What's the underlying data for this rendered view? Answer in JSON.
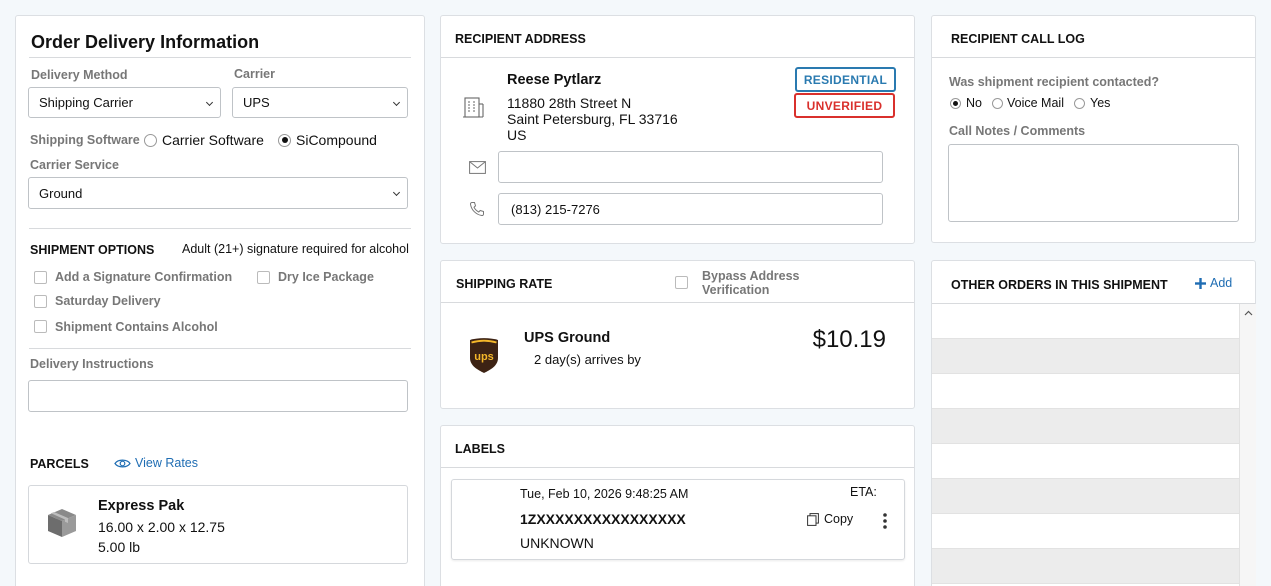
{
  "order": {
    "title": "Order Delivery Information",
    "delivery_method_label": "Delivery Method",
    "delivery_method_value": "Shipping Carrier",
    "carrier_label": "Carrier",
    "carrier_value": "UPS",
    "shipping_software_label": "Shipping Software",
    "software_options": [
      "Carrier Software",
      "SiCompound"
    ],
    "software_selected": "SiCompound",
    "carrier_service_label": "Carrier Service",
    "carrier_service_value": "Ground",
    "shipment_options_header": "SHIPMENT OPTIONS",
    "alcohol_note": "Adult (21+) signature required for alcohol",
    "options": {
      "signature": "Add a Signature Confirmation",
      "dry_ice": "Dry Ice Package",
      "saturday": "Saturday Delivery",
      "alcohol": "Shipment Contains Alcohol"
    },
    "delivery_instructions_label": "Delivery Instructions",
    "delivery_instructions_value": "",
    "parcels_header": "PARCELS",
    "view_rates": "View Rates",
    "parcel": {
      "name": "Express Pak",
      "dimensions": "16.00 x 2.00 x 12.75",
      "weight": "5.00 lb",
      "icon": "package-box-icon"
    }
  },
  "recipient": {
    "header": "RECIPIENT ADDRESS",
    "name": "Reese Pytlarz",
    "street": "11880 28th Street N",
    "city_line": "Saint Petersburg, FL 33716",
    "country": "US",
    "badge_residential": "RESIDENTIAL",
    "badge_unverified": "UNVERIFIED",
    "email_value": "",
    "phone_value": "(813) 215-7276",
    "colors": {
      "residential": "#2a7ab0",
      "unverified": "#d9302c"
    }
  },
  "shipping_rate": {
    "header": "SHIPPING RATE",
    "bypass_label_1": "Bypass Address",
    "bypass_label_2": "Verification",
    "service": "UPS Ground",
    "transit": "2 day(s) arrives by",
    "price": "$10.19",
    "carrier_logo_text": "ups",
    "colors": {
      "ups_brown": "#3d2314",
      "ups_gold": "#f5b82a"
    }
  },
  "labels": {
    "header": "LABELS",
    "date": "Tue, Feb 10, 2026 9:48:25 AM",
    "eta_label": "ETA:",
    "tracking": "1ZXXXXXXXXXXXXXXXX",
    "status": "UNKNOWN",
    "copy": "Copy"
  },
  "call_log": {
    "header": "RECIPIENT CALL LOG",
    "question": "Was shipment recipient contacted?",
    "options": [
      "No",
      "Voice Mail",
      "Yes"
    ],
    "selected": "No",
    "notes_label": "Call Notes / Comments",
    "notes_value": ""
  },
  "other_orders": {
    "header": "OTHER ORDERS IN THIS SHIPMENT",
    "add_label": "Add"
  }
}
